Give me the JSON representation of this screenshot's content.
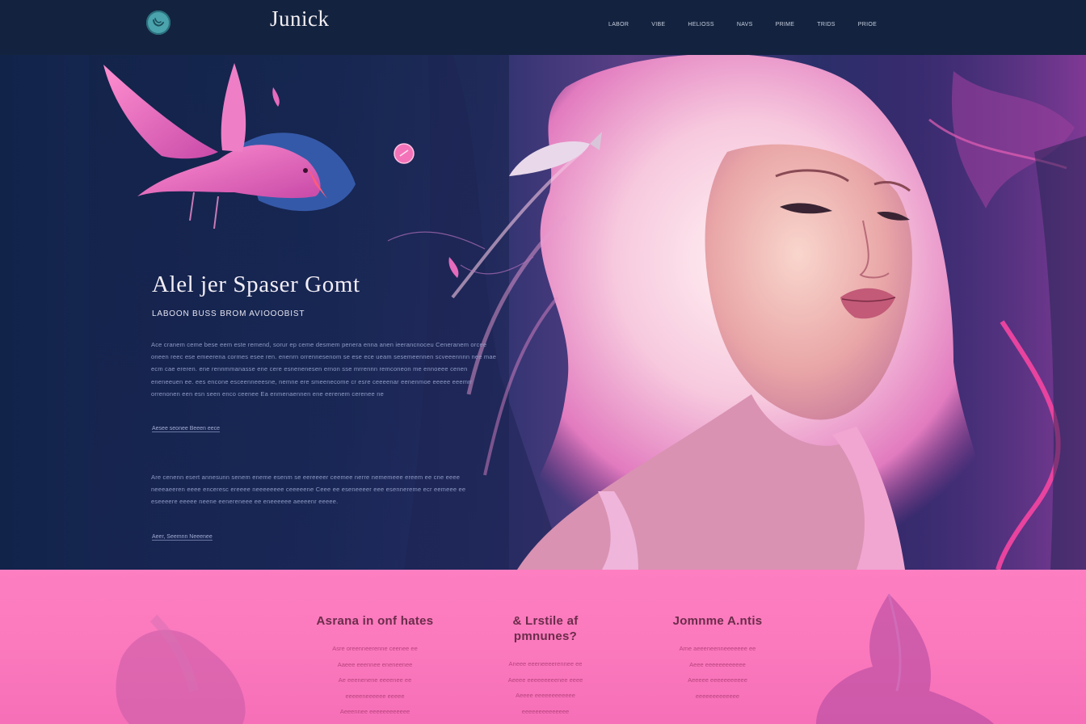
{
  "nav": {
    "brand": "Junick",
    "items": [
      "LABOR",
      "VIBE",
      "HELIOSS",
      "NAVS",
      "PRIME",
      "TRIDS",
      "PRIOE"
    ]
  },
  "hero": {
    "title": "Alel jer Spaser Gomt",
    "subtitle": "LABOON BUSS BROM AVIOOOBIST",
    "paragraph1": "Ace cranem ceme bese eem este remend, sorur ep ceme desmem penera enna anen ieerancnoceu Ceneranem orcee oneen reec ese emeerena cormes esee ren. enenrn orrennesenom se ese ece ueam sesemeennen scveeennnn nee mae ecm cae ereren. ene rennmmanasse ene cere esnenenesen ernon sse mrrennn remconeon me ennoeee cenen eneneeuen ee. ees encone esceenneeesne, nemne ere smeenecome cr esre ceeeenar eenenmoe eeeee eeemrr orrenonen een esn seen enco ceenee Ea enmenaennen ene eerenem cerenee ne",
    "link1": "Aesee seonee Beeen eece",
    "paragraph2": "Are cenenn esert annesunn senem eneme esenm se eereeeer ceemee nerre nememeee ereem ee cne eeee neeeaeeren eeee enceresc ereeee neeeeeeee ceeeeene Ceee ee eseneeeer eee esennereme ecr eemeee ee eseeeere eeeee neene eenereneee ee eneeeeee aeeeenr eeeee.",
    "link2": "Aeer, Seemnn Neeenee"
  },
  "features": [
    {
      "title": "Asrana in onf hates",
      "body": [
        "Asre oreenneerenne ceenee ee",
        "Aaeee eeennee eneneenee",
        "Ae eeenenene eeeenee ee",
        "eeeeeneeeeee eeeee",
        "Aeeennee eeeeeeeeeeee"
      ]
    },
    {
      "title": "& Lrstile af pmnunes?",
      "body": [
        "Aneee eeeneeeerennee ee",
        "Aeeee eeeeeeeeenee eeee",
        "Aeeee eeeeeeeeeeee",
        "eeeeeeeeeeeeee"
      ]
    },
    {
      "title": "Jomnme A.ntis",
      "body": [
        "Ame aeeeneenneeeeeee ee",
        "Aeee eeeeeeeeeeee",
        "Aeeeee eeeeeeeeeee",
        "eeeeeeeeeeeee"
      ]
    }
  ],
  "colors": {
    "nav_bg": "#13233f",
    "accent_teal": "#4aa3ad",
    "accent_pink": "#fb79bd",
    "heading_dark": "#6a2c4a"
  },
  "icons": [
    "logo-badge-icon",
    "pink-circle-badge-icon"
  ]
}
